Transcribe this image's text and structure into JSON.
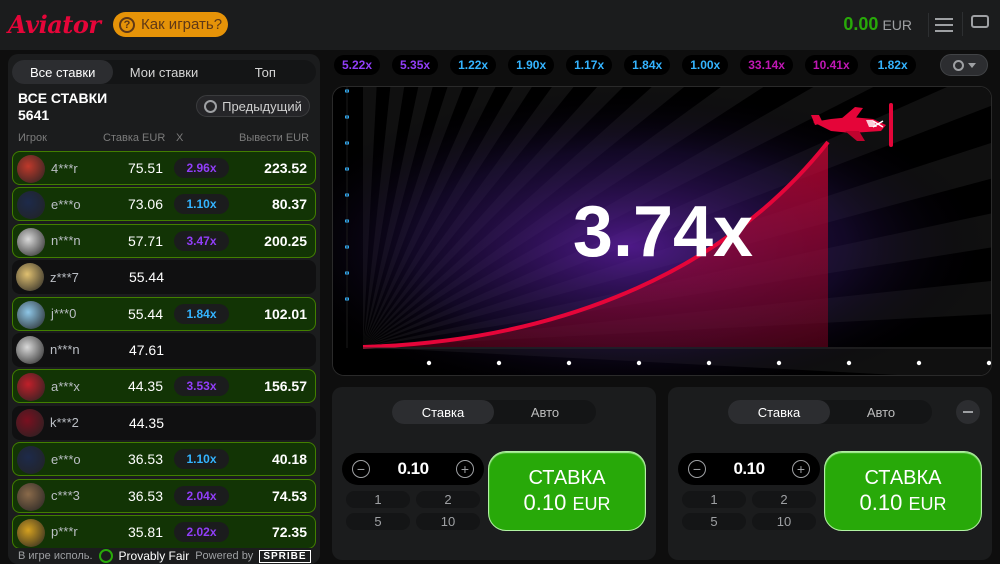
{
  "header": {
    "logo": "Aviator",
    "how_to_play": "Как играть?",
    "balance": "0.00",
    "currency": "EUR"
  },
  "left_panel": {
    "tabs": [
      {
        "label": "Все ставки",
        "active": true
      },
      {
        "label": "Мои ставки",
        "active": false
      },
      {
        "label": "Топ",
        "active": false
      }
    ],
    "title": "ВСЕ СТАВКИ",
    "count": "5641",
    "previous_label": "Предыдущий",
    "columns": {
      "player": "Игрок",
      "bet": "Ставка EUR",
      "x": "X",
      "cashout": "Вывести EUR"
    },
    "rows": [
      {
        "user": "4***r",
        "bet": "75.51",
        "mult": "2.96x",
        "cashout": "223.52",
        "win": true,
        "mult_color": "#913ef8",
        "avatar": "#c0392b"
      },
      {
        "user": "e***o",
        "bet": "73.06",
        "mult": "1.10x",
        "cashout": "80.37",
        "win": true,
        "mult_color": "#34b4ff",
        "avatar": "#1d2a4a"
      },
      {
        "user": "n***n",
        "bet": "57.71",
        "mult": "3.47x",
        "cashout": "200.25",
        "win": true,
        "mult_color": "#913ef8",
        "avatar": "#d9d9d9"
      },
      {
        "user": "z***7",
        "bet": "55.44",
        "mult": "",
        "cashout": "",
        "win": false,
        "mult_color": "",
        "avatar": "#e0c070"
      },
      {
        "user": "j***0",
        "bet": "55.44",
        "mult": "1.84x",
        "cashout": "102.01",
        "win": true,
        "mult_color": "#34b4ff",
        "avatar": "#8ec6e6"
      },
      {
        "user": "n***n",
        "bet": "47.61",
        "mult": "",
        "cashout": "",
        "win": false,
        "mult_color": "",
        "avatar": "#d9d9d9"
      },
      {
        "user": "a***x",
        "bet": "44.35",
        "mult": "3.53x",
        "cashout": "156.57",
        "win": true,
        "mult_color": "#913ef8",
        "avatar": "#c0202a"
      },
      {
        "user": "k***2",
        "bet": "44.35",
        "mult": "",
        "cashout": "",
        "win": false,
        "mult_color": "",
        "avatar": "#7a1020"
      },
      {
        "user": "e***o",
        "bet": "36.53",
        "mult": "1.10x",
        "cashout": "40.18",
        "win": true,
        "mult_color": "#34b4ff",
        "avatar": "#1d2a4a"
      },
      {
        "user": "c***3",
        "bet": "36.53",
        "mult": "2.04x",
        "cashout": "74.53",
        "win": true,
        "mult_color": "#913ef8",
        "avatar": "#8a6a4a"
      },
      {
        "user": "p***r",
        "bet": "35.81",
        "mult": "2.02x",
        "cashout": "72.35",
        "win": true,
        "mult_color": "#913ef8",
        "avatar": "#d4a020"
      }
    ],
    "footer": {
      "in_game": "В игре исполь.",
      "provably_fair": "Provably Fair",
      "powered_by": "Powered by",
      "brand": "SPRIBE"
    }
  },
  "history": [
    {
      "value": "5.22x",
      "color": "#913ef8"
    },
    {
      "value": "5.35x",
      "color": "#913ef8"
    },
    {
      "value": "1.22x",
      "color": "#34b4ff"
    },
    {
      "value": "1.90x",
      "color": "#34b4ff"
    },
    {
      "value": "1.17x",
      "color": "#34b4ff"
    },
    {
      "value": "1.84x",
      "color": "#34b4ff"
    },
    {
      "value": "1.00x",
      "color": "#34b4ff"
    },
    {
      "value": "33.14x",
      "color": "#c017b4"
    },
    {
      "value": "10.41x",
      "color": "#c017b4"
    },
    {
      "value": "1.82x",
      "color": "#34b4ff"
    }
  ],
  "game": {
    "multiplier": "3.74x",
    "curve_color": "#e50539"
  },
  "bet_panels": [
    {
      "tabs": [
        "Ставка",
        "Авто"
      ],
      "amount": "0.10",
      "quick": [
        "1",
        "2",
        "5",
        "10"
      ],
      "button_line1": "СТАВКА",
      "button_amount": "0.10",
      "button_currency": "EUR"
    },
    {
      "tabs": [
        "Ставка",
        "Авто"
      ],
      "amount": "0.10",
      "quick": [
        "1",
        "2",
        "5",
        "10"
      ],
      "button_line1": "СТАВКА",
      "button_amount": "0.10",
      "button_currency": "EUR"
    }
  ],
  "colors": {
    "accent_green": "#28a909",
    "brand_red": "#e50539",
    "howto_bg": "#e69308"
  }
}
